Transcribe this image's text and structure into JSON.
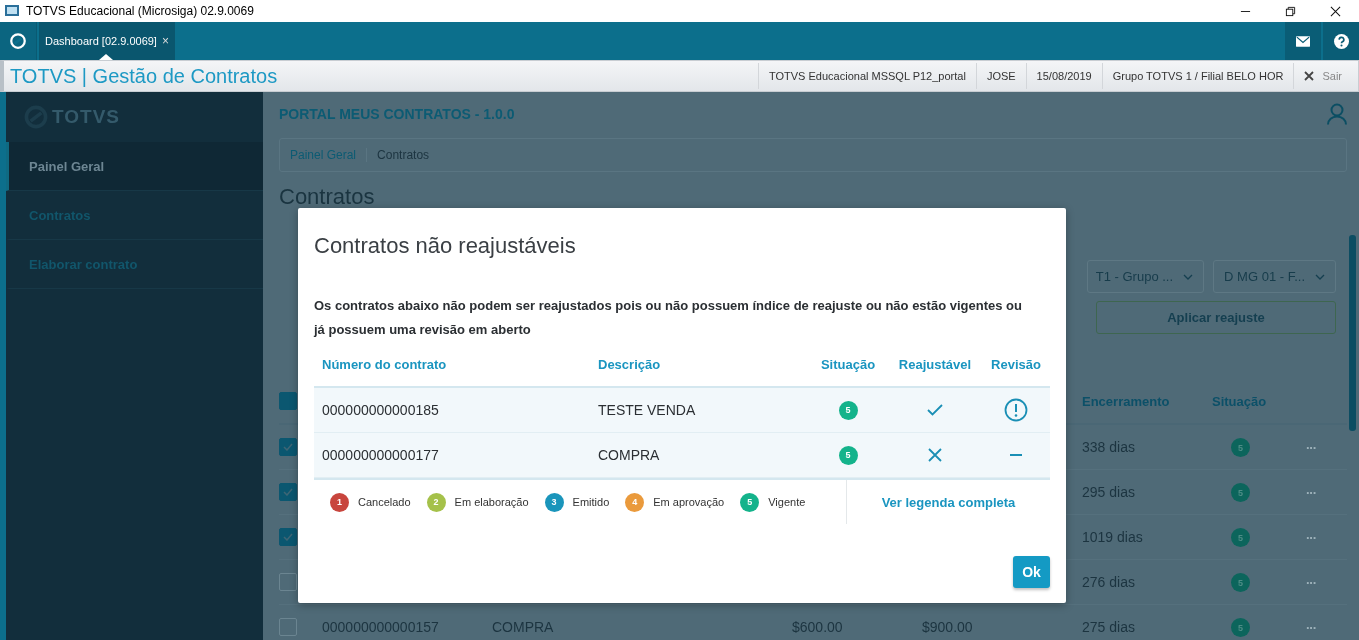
{
  "window": {
    "title": "TOTVS Educacional (Microsiga) 02.9.0069"
  },
  "tabs": [
    {
      "label": "Dashboard [02.9.0069]",
      "close": "×",
      "selected": true
    }
  ],
  "app_header": {
    "title": "TOTVS | Gestão de Contratos",
    "info": [
      "TOTVS Educacional MSSQL P12_portal",
      "JOSE",
      "15/08/2019",
      "Grupo TOTVS 1 / Filial BELO HOR"
    ],
    "logout": "Sair"
  },
  "sidebar": {
    "logo": "TOTVS",
    "items": [
      {
        "label": "Painel Geral",
        "selected": true
      },
      {
        "label": "Contratos",
        "selected": false
      },
      {
        "label": "Elaborar contrato",
        "selected": false
      }
    ]
  },
  "page": {
    "portal_title": "PORTAL MEUS CONTRATOS - 1.0.0",
    "breadcrumb": [
      "Painel Geral",
      "Contratos"
    ],
    "heading": "Contratos",
    "filters": [
      "T1 - Grupo ...",
      "D MG 01 - F..."
    ],
    "apply_button": "Aplicar reajuste",
    "table": {
      "header_checked": true,
      "columns": [
        "Encerramento",
        "Situação"
      ],
      "rows": [
        {
          "checked": true,
          "closing": "338 dias",
          "status": "5",
          "more": "···"
        },
        {
          "checked": true,
          "closing": "295 dias",
          "status": "5",
          "more": "···"
        },
        {
          "checked": true,
          "closing": "1019 dias",
          "status": "5",
          "more": "···"
        },
        {
          "checked": false,
          "closing": "276 dias",
          "status": "5",
          "more": "···"
        },
        {
          "checked": false,
          "number": "000000000000157",
          "description": "COMPRA",
          "value": "$600.00",
          "total": "$900.00",
          "closing": "275 dias",
          "status": "5",
          "more": "···"
        }
      ]
    }
  },
  "dialog": {
    "title": "Contratos não reajustáveis",
    "message": "Os contratos abaixo não podem ser reajustados pois ou não possuem índice de reajuste ou não estão vigentes ou já possuem uma revisão em aberto",
    "columns": [
      "Número do contrato",
      "Descrição",
      "Situação",
      "Reajustável",
      "Revisão"
    ],
    "rows": [
      {
        "number": "000000000000185",
        "description": "TESTE VENDA",
        "status": "5",
        "color": "#14b38b",
        "adjustable": true,
        "revision_open": true
      },
      {
        "number": "000000000000177",
        "description": "COMPRA",
        "status": "5",
        "color": "#14b38b",
        "adjustable": false,
        "revision_open": false
      }
    ],
    "legend": [
      {
        "number": "1",
        "label": "Cancelado",
        "color": "#c8453d"
      },
      {
        "number": "2",
        "label": "Em elaboração",
        "color": "#a5c14a"
      },
      {
        "number": "3",
        "label": "Emitido",
        "color": "#1a95bb"
      },
      {
        "number": "4",
        "label": "Em aprovação",
        "color": "#ea9a3c"
      },
      {
        "number": "5",
        "label": "Vigente",
        "color": "#14b38b"
      }
    ],
    "legend_link": "Ver legenda completa",
    "ok_button": "Ok"
  }
}
